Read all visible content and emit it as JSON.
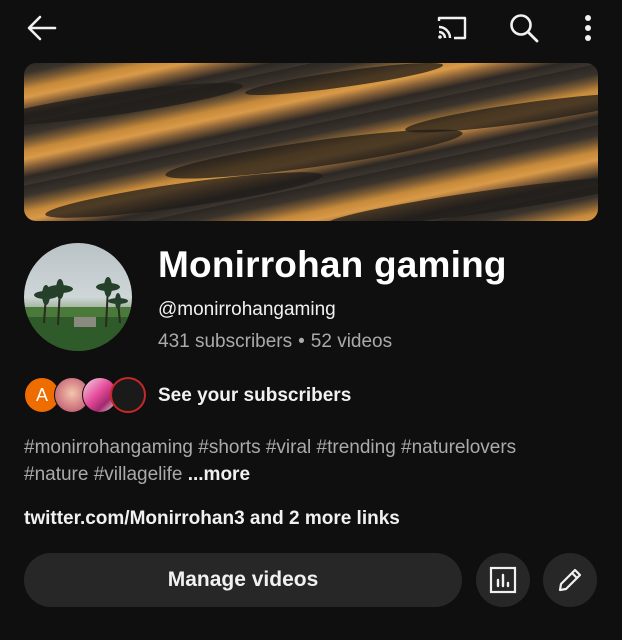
{
  "header": {
    "back_icon": "arrow-left-icon",
    "cast_icon": "cast-icon",
    "search_icon": "search-icon",
    "more_icon": "more-vert-icon"
  },
  "channel": {
    "name": "Monirrohan gaming",
    "handle": "@monirrohangaming",
    "subscribers": "431 subscribers",
    "separator": "•",
    "videos": "52 videos"
  },
  "subscribers_row": {
    "first_avatar_letter": "A",
    "label": "See your subscribers"
  },
  "description": {
    "text": "#monirrohangaming #shorts #viral #trending  #naturelovers #nature #villagelife ",
    "more_label": "...more"
  },
  "links": {
    "text": "twitter.com/Monirrohan3 and 2 more links"
  },
  "actions": {
    "manage_videos_label": "Manage videos",
    "analytics_icon": "analytics-icon",
    "edit_icon": "edit-icon"
  },
  "colors": {
    "background": "#0f0f0f",
    "button_bg": "#272727",
    "primary_text": "#f1f1f1",
    "secondary_text": "#aaaaaa"
  }
}
